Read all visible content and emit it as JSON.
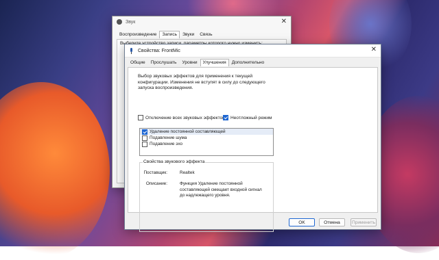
{
  "background_window": {
    "title": "Звук",
    "tabs": [
      "Воспроизведение",
      "Запись",
      "Звуки",
      "Связь"
    ],
    "active_tab": 1,
    "prompt": "Выберите устройство записи, параметры которого нужно изменить:"
  },
  "dialog": {
    "title": "Свойства: FrontMic",
    "tabs": [
      "Общие",
      "Прослушать",
      "Уровни",
      "Улучшения",
      "Дополнительно"
    ],
    "active_tab": 3,
    "description": "Выбор звуковых эффектов для применения к текущей конфигурации. Изменения не вступят в силу до следующего запуска воспроизведения.",
    "disable_all_label": "Отключение всех звуковых эффектов",
    "disable_all_checked": false,
    "immediate_mode_label": "Неотложный режим",
    "immediate_mode_checked": true,
    "effects": [
      {
        "label": "Удаление постоянной составляющей",
        "checked": true
      },
      {
        "label": "Подавление шума",
        "checked": false
      },
      {
        "label": "Подавление эхо",
        "checked": false
      }
    ],
    "properties": {
      "group_title": "Свойства звукового эффекта",
      "provider_label": "Поставщик:",
      "provider_value": "Realtek",
      "description_label": "Описание:",
      "description_value": "Функция Удаление постоянной составляющей смещает входной сигнал до надлежащего уровня."
    },
    "buttons": {
      "ok": "OK",
      "cancel": "Отмена",
      "apply": "Применить"
    }
  },
  "colors": {
    "accent": "#1f67d2"
  }
}
